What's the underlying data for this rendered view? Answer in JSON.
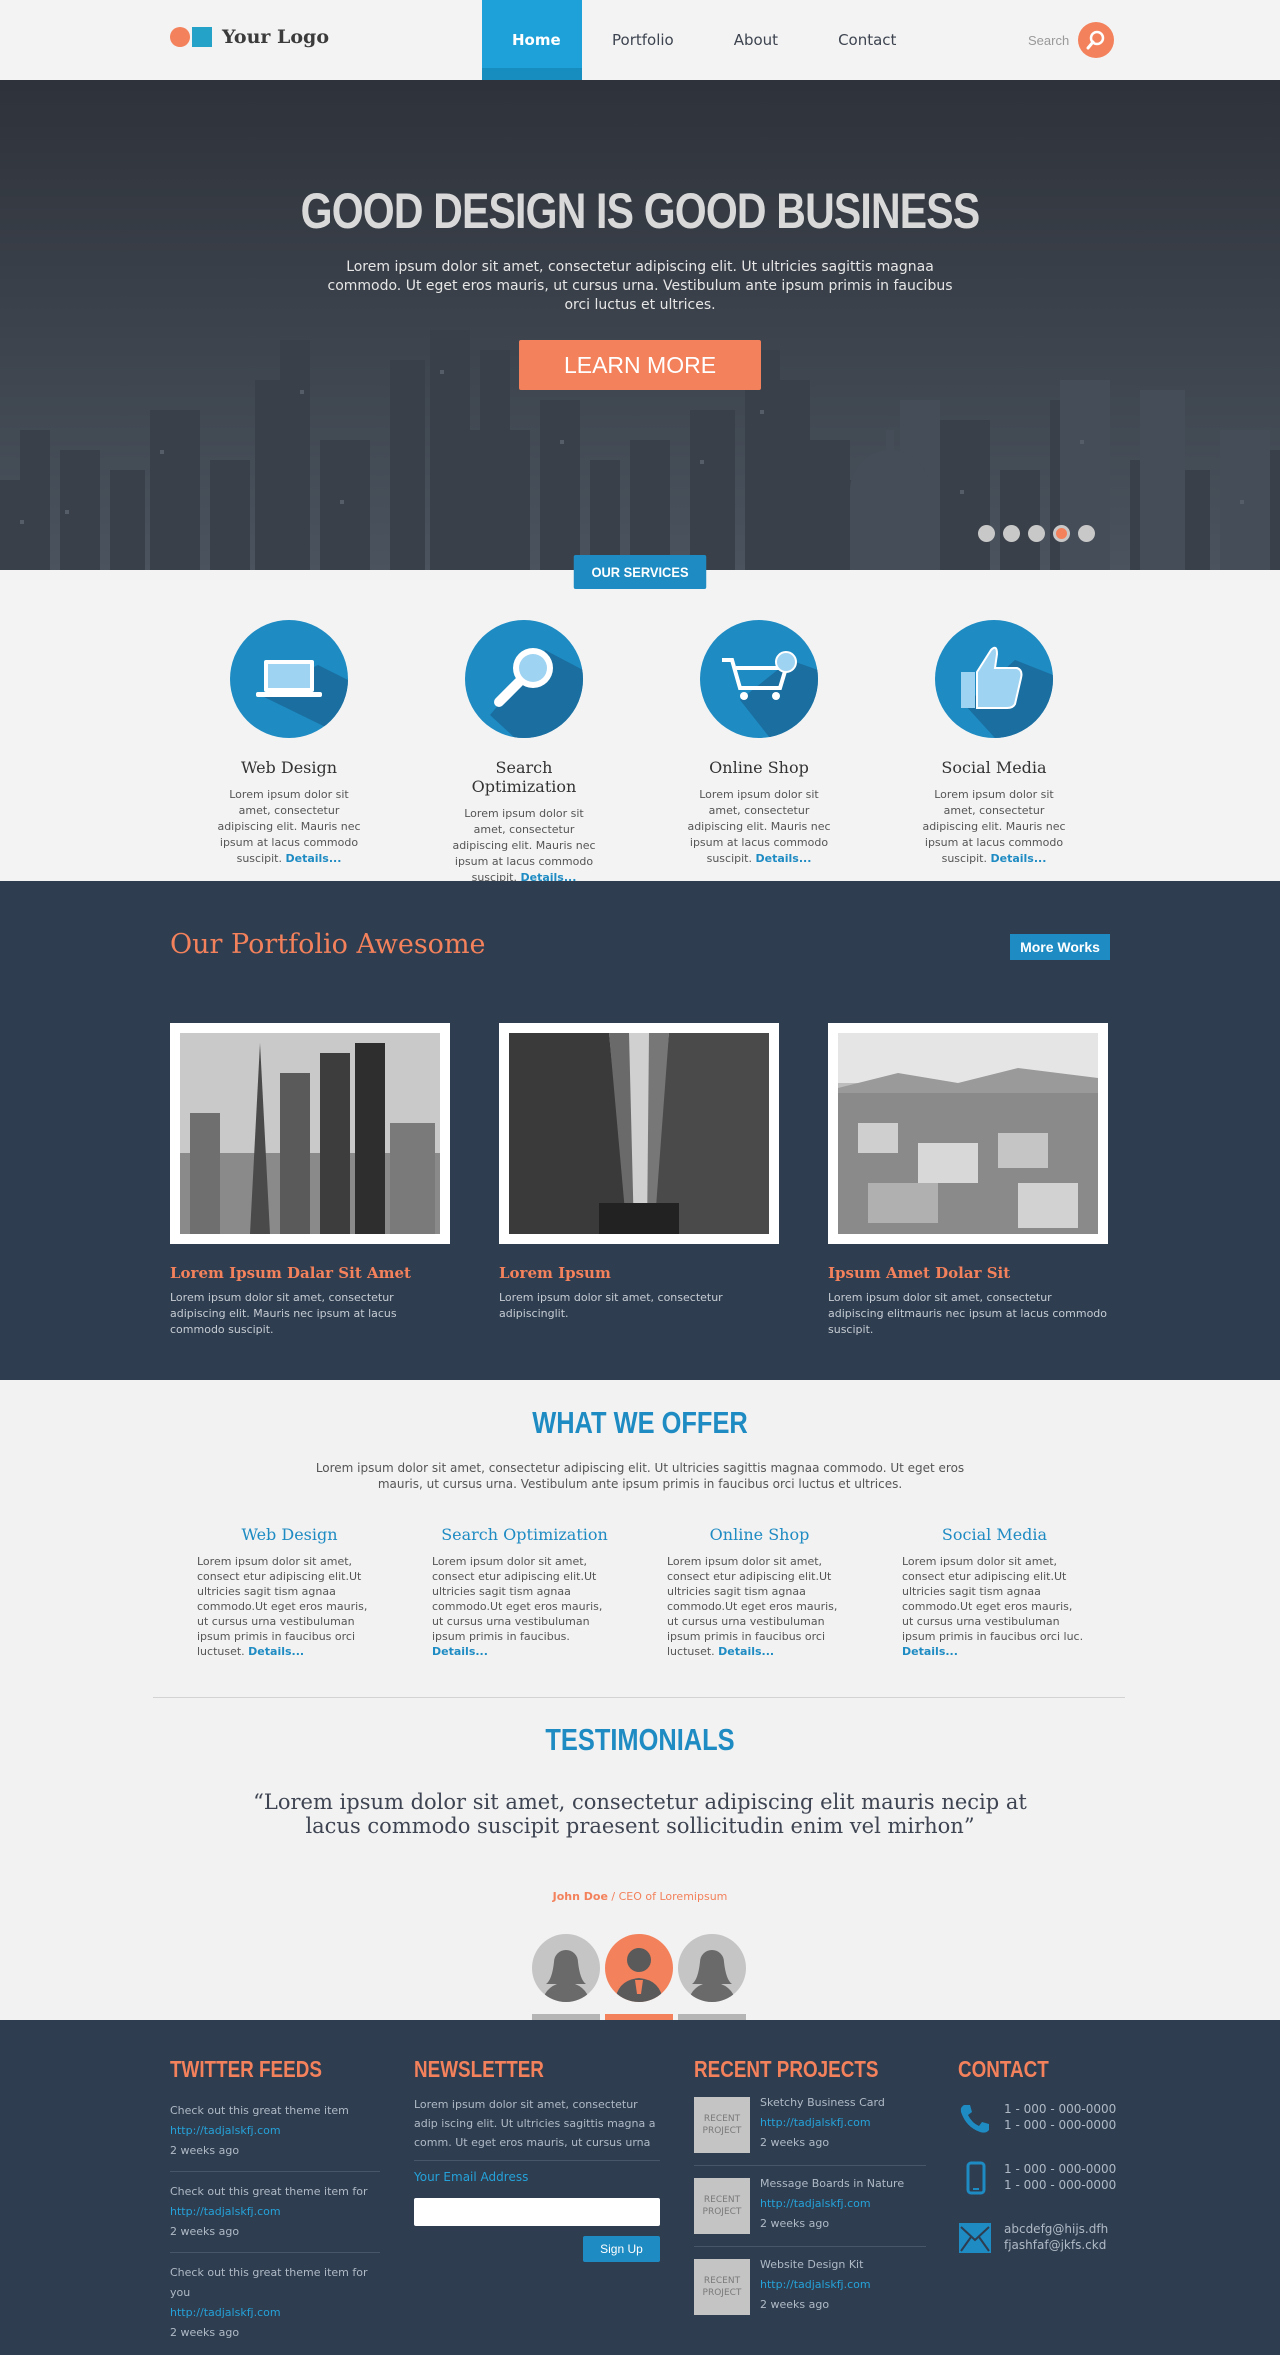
{
  "header": {
    "logo_text": "Your Logo",
    "nav": [
      "Home",
      "Portfolio",
      "About",
      "Contact"
    ],
    "search_placeholder": "Search"
  },
  "hero": {
    "title": "GOOD DESIGN IS GOOD BUSINESS",
    "subtitle": "Lorem ipsum dolor sit amet, consectetur adipiscing elit. Ut ultricies sagittis magnaa commodo. Ut eget eros mauris, ut cursus urna. Vestibulum ante ipsum primis in faucibus orci luctus et ultrices.",
    "button": "LEARN MORE",
    "slides": 5,
    "active_slide": 4
  },
  "services": {
    "badge": "OUR SERVICES",
    "items": [
      {
        "title": "Web Design",
        "text": "Lorem ipsum dolor sit amet, consectetur adipiscing elit. Mauris nec ipsum at lacus commodo suscipit.",
        "link": "Details...",
        "icon": "laptop-icon"
      },
      {
        "title": "Search Optimization",
        "text": "Lorem ipsum dolor sit amet, consectetur adipiscing elit. Mauris nec ipsum at lacus commodo suscipit.",
        "link": "Details...",
        "icon": "magnifier-icon"
      },
      {
        "title": "Online Shop",
        "text": "Lorem ipsum dolor sit amet, consectetur adipiscing elit. Mauris nec ipsum at lacus commodo suscipit.",
        "link": "Details...",
        "icon": "cart-icon"
      },
      {
        "title": "Social Media",
        "text": "Lorem ipsum dolor sit amet, consectetur adipiscing elit. Mauris nec ipsum at lacus commodo suscipit.",
        "link": "Details...",
        "icon": "thumbs-up-icon"
      }
    ]
  },
  "portfolio": {
    "title": "Our Portfolio Awesome",
    "more_button": "More Works",
    "items": [
      {
        "title": "Lorem Ipsum Dalar Sit Amet",
        "text": "Lorem ipsum dolor sit amet, consectetur adipiscing elit. Mauris nec ipsum at lacus commodo suscipit."
      },
      {
        "title": "Lorem Ipsum",
        "text": "Lorem ipsum dolor sit amet, consectetur adipiscinglit."
      },
      {
        "title": "Ipsum Amet Dolar Sit",
        "text": "Lorem ipsum dolor sit amet, consectetur adipiscing elitmauris nec ipsum at lacus commodo suscipit."
      }
    ]
  },
  "offer": {
    "title": "WHAT WE OFFER",
    "subtitle": "Lorem ipsum dolor sit amet, consectetur adipiscing elit. Ut ultricies sagittis magnaa commodo. Ut eget eros mauris, ut cursus urna. Vestibulum ante ipsum primis in faucibus orci luctus et ultrices.",
    "items": [
      {
        "title": "Web Design",
        "text": "Lorem ipsum dolor sit amet, consect etur adipiscing elit.Ut ultricies sagit tism agnaa commodo.Ut eget eros mauris, ut cursus urna vestibuluman ipsum primis in faucibus orci luctuset.",
        "link": "Details..."
      },
      {
        "title": "Search Optimization",
        "text": "Lorem ipsum dolor sit amet, consect etur adipiscing elit.Ut ultricies sagit tism agnaa commodo.Ut eget eros mauris, ut cursus urna vestibuluman ipsum primis in faucibus.",
        "link": "Details..."
      },
      {
        "title": "Online Shop",
        "text": "Lorem ipsum dolor sit amet, consect etur adipiscing elit.Ut ultricies sagit tism agnaa commodo.Ut eget eros mauris, ut cursus urna vestibuluman ipsum primis in faucibus orci luctuset.",
        "link": "Details..."
      },
      {
        "title": "Social Media",
        "text": "Lorem ipsum dolor sit amet, consect etur adipiscing elit.Ut ultricies sagit tism agnaa commodo.Ut eget eros mauris, ut cursus urna vestibuluman ipsum primis in faucibus orci luc.",
        "link": "Details..."
      }
    ]
  },
  "testimonials": {
    "title": "TESTIMONIALS",
    "quote": "“Lorem ipsum dolor sit amet, consectetur adipiscing elit mauris necip at lacus commodo suscipit praesent sollicitudin enim vel mirhon”",
    "author_name": "John Doe",
    "author_role": " / CEO of Loremipsum"
  },
  "footer": {
    "twitter": {
      "title": "TWITTER FEEDS",
      "tweets": [
        {
          "text": "Check out this great theme item",
          "link": "http://tadjalskfj.com",
          "time": "2 weeks ago"
        },
        {
          "text": "Check out this great theme item for",
          "link": "http://tadjalskfj.com",
          "time": "2 weeks ago"
        },
        {
          "text": "Check out this great theme item for you",
          "link": "http://tadjalskfj.com",
          "time": "2 weeks ago"
        }
      ]
    },
    "newsletter": {
      "title": "NEWSLETTER",
      "text": "Lorem ipsum dolor sit amet, consectetur adip iscing elit. Ut ultricies sagittis magna a comm. Ut eget eros mauris, ut cursus urna",
      "label": "Your Email Address",
      "button": "Sign Up"
    },
    "projects": {
      "title": "RECENT PROJECTS",
      "thumb_label": "RECENT PROJECT",
      "items": [
        {
          "name": "Sketchy Business Card",
          "link": "http://tadjalskfj.com",
          "time": "2 weeks ago"
        },
        {
          "name": "Message Boards in Nature",
          "link": "http://tadjalskfj.com",
          "time": "2 weeks ago"
        },
        {
          "name": "Website Design Kit",
          "link": "http://tadjalskfj.com",
          "time": "2 weeks ago"
        }
      ]
    },
    "contact": {
      "title": "CONTACT",
      "phone1": "1 - 000 - 000-0000",
      "phone2": "1 - 000 - 000-0000",
      "mobile1": "1 - 000 - 000-0000",
      "mobile2": "1 - 000 - 000-0000",
      "email1": "abcdefg@hijs.dfh",
      "email2": "fjashfaf@jkfs.ckd"
    }
  },
  "colors": {
    "accent": "#f3815b",
    "blue": "#1e8bc3",
    "dark": "#2e3d50"
  }
}
